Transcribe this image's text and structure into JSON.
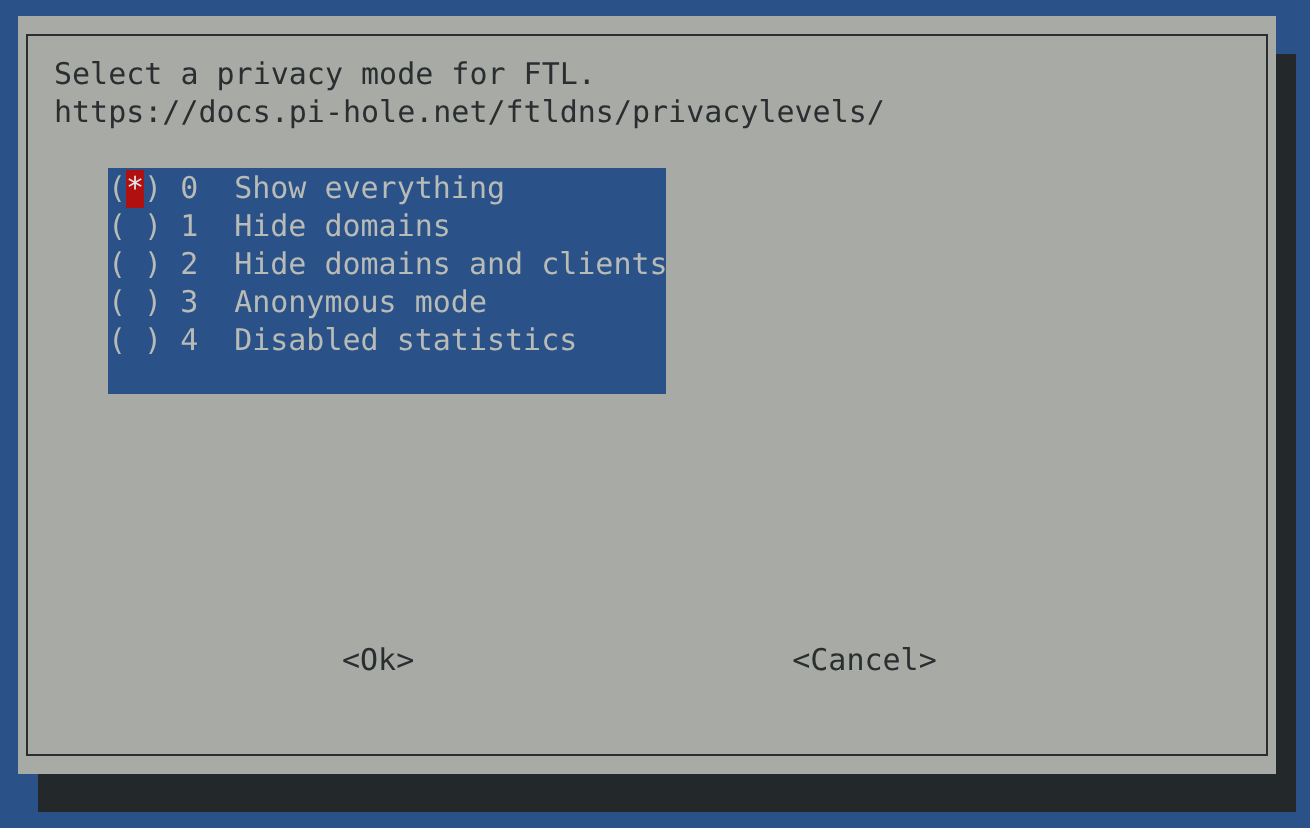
{
  "dialog": {
    "prompt": "Select a privacy mode for FTL.",
    "link": "https://docs.pi-hole.net/ftldns/privacylevels/",
    "radio": {
      "open": "(",
      "mark": "*",
      "close": ")"
    },
    "options": [
      {
        "value": "0",
        "label": "Show everything",
        "selected": true
      },
      {
        "value": "1",
        "label": "Hide domains",
        "selected": false
      },
      {
        "value": "2",
        "label": "Hide domains and clients",
        "selected": false
      },
      {
        "value": "3",
        "label": "Anonymous mode",
        "selected": false
      },
      {
        "value": "4",
        "label": "Disabled statistics",
        "selected": false
      }
    ],
    "buttons": [
      "<Ok>",
      "<Cancel>"
    ]
  }
}
